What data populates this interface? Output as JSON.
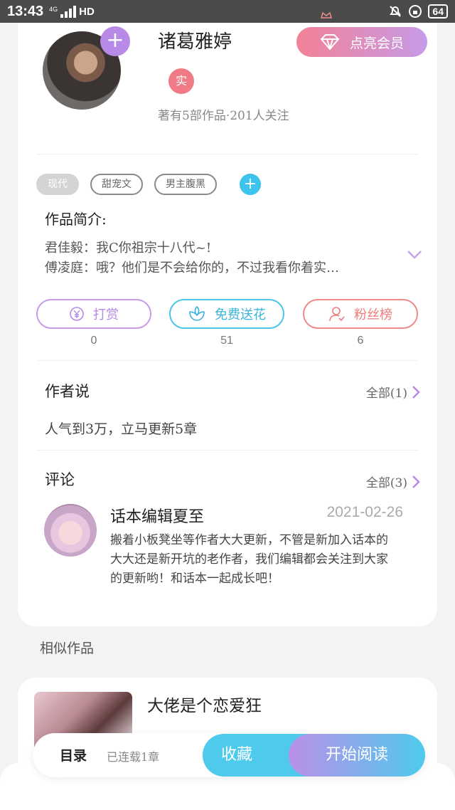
{
  "status_bar": {
    "time": "13:43",
    "network": "4G",
    "hd": "HD",
    "battery": "64"
  },
  "author": {
    "name": "诸葛雅婷",
    "verified_badge": "实",
    "stats": "著有5部作品·201人关注",
    "vip_button": "点亮会员"
  },
  "tags": [
    "现代",
    "甜宠文",
    "男主腹黑"
  ],
  "intro": {
    "title": "作品简介:",
    "lines": [
      "君佳毅：我C你祖宗十八代~!",
      "傅凌庭：哦？他们是不会给你的，不过我看你着实…"
    ]
  },
  "actions": [
    {
      "label": "打赏",
      "count": "0"
    },
    {
      "label": "免费送花",
      "count": "51"
    },
    {
      "label": "粉丝榜",
      "count": "6"
    }
  ],
  "author_says": {
    "title": "作者说",
    "all": "全部(1)",
    "text": "人气到3万，立马更新5章"
  },
  "comments": {
    "title": "评论",
    "all": "全部(3)",
    "first": {
      "name": "话本编辑夏至",
      "date": "2021-02-26",
      "text": "搬着小板凳坐等作者大大更新，不管是新加入话本的大大还是新开坑的老作者，我们编辑都会关注到大家的更新哟！和话本一起成长吧！"
    }
  },
  "similar": {
    "title": "相似作品",
    "first_book": "大佬是个恋爱狂"
  },
  "bottom": {
    "toc": "目录",
    "serial": "已连载1章",
    "collect": "收藏",
    "read": "开始阅读"
  },
  "colors": {
    "purple": "#b78ae8",
    "cyan": "#4fcaed",
    "coral": "#f07b7b"
  }
}
